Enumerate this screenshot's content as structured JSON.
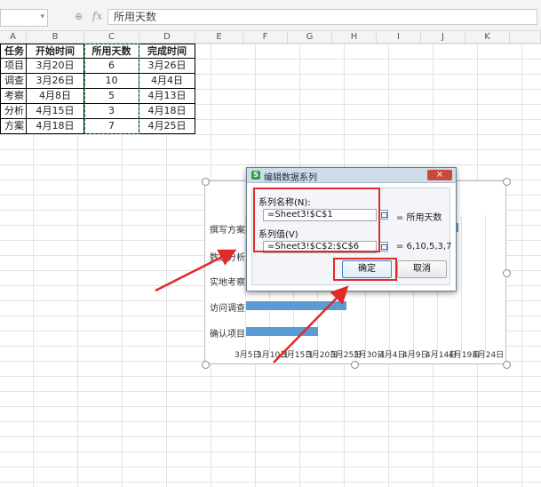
{
  "formula_bar": {
    "fx": "fx",
    "value": "所用天数"
  },
  "columns": [
    "A",
    "B",
    "C",
    "D",
    "E",
    "F",
    "G",
    "H",
    "I",
    "J",
    "K"
  ],
  "table": {
    "headers": [
      "任务",
      "开始时间",
      "所用天数",
      "完成时间"
    ],
    "rows": [
      [
        "项目",
        "3月20日",
        "6",
        "3月26日"
      ],
      [
        "调查",
        "3月26日",
        "10",
        "4月4日"
      ],
      [
        "考察",
        "4月8日",
        "5",
        "4月13日"
      ],
      [
        "分析",
        "4月15日",
        "3",
        "4月18日"
      ],
      [
        "方案",
        "4月18日",
        "7",
        "4月25日"
      ]
    ]
  },
  "chart": {
    "categories": [
      "撰写方案",
      "数据分析",
      "实地考察",
      "访问调查",
      "确认项目"
    ],
    "x_ticks": [
      "3月5日",
      "3月10日",
      "3月15日",
      "3月20日",
      "3月25日",
      "3月30日",
      "4月4日",
      "4月9日",
      "4月14日",
      "4月19日",
      "4月24日"
    ]
  },
  "chart_data": {
    "type": "bar",
    "categories": [
      "确认项目",
      "访问调查",
      "实地考察",
      "数据分析",
      "撰写方案"
    ],
    "series": [
      {
        "name": "所用天数",
        "values": [
          6,
          10,
          5,
          3,
          7
        ]
      }
    ],
    "x_ticks": [
      "3月5日",
      "3月10日",
      "3月15日",
      "3月20日",
      "3月25日",
      "3月30日",
      "4月4日",
      "4月9日",
      "4月14日",
      "4月19日",
      "4月24日"
    ]
  },
  "dialog": {
    "title": "编辑数据系列",
    "close": "×",
    "series_name_label": "系列名称(N):",
    "series_name_ref": "=Sheet3!$C$1",
    "series_name_preview": "= 所用天数",
    "series_values_label": "系列值(V)",
    "series_values_ref": "=Sheet3!$C$2:$C$6",
    "series_values_preview": "= 6,10,5,3,7",
    "ok": "确定",
    "cancel": "取消",
    "icon_letter": "S"
  },
  "colors": {
    "highlight": "#e02b2b",
    "bar": "#5b9bd5",
    "copy_border": "#1a9e3d"
  }
}
